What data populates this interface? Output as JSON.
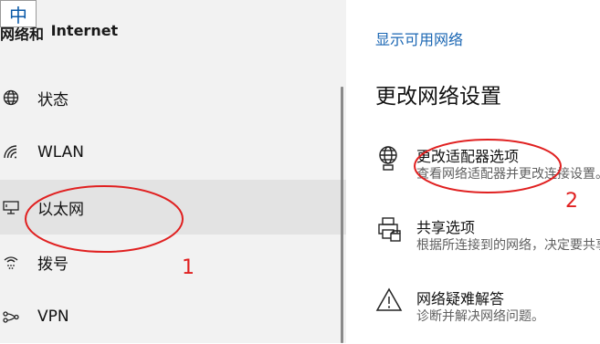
{
  "ime": {
    "label": "中"
  },
  "sidebar": {
    "header": {
      "prefix": "网络和",
      "text": "Internet"
    },
    "items": [
      {
        "label": "状态",
        "icon": "globe-icon"
      },
      {
        "label": "WLAN",
        "icon": "wifi-icon"
      },
      {
        "label": "以太网",
        "icon": "ethernet-icon",
        "selected": true
      },
      {
        "label": "拨号",
        "icon": "dialup-icon"
      },
      {
        "label": "VPN",
        "icon": "vpn-icon"
      }
    ]
  },
  "main": {
    "show_networks_link": "显示可用网络",
    "section_title": "更改网络设置",
    "options": [
      {
        "title": "更改适配器选项",
        "desc": "查看网络适配器并更改连接设置。",
        "icon": "adapter-globe-icon"
      },
      {
        "title": "共享选项",
        "desc": "根据所连接到的网络，决定要共享的内容。",
        "icon": "sharing-printer-icon"
      },
      {
        "title": "网络疑难解答",
        "desc": "诊断并解决网络问题。",
        "icon": "warning-triangle-icon"
      }
    ]
  },
  "annotations": [
    {
      "label": "1",
      "color": "#e02020"
    },
    {
      "label": "2",
      "color": "#e02020"
    }
  ]
}
